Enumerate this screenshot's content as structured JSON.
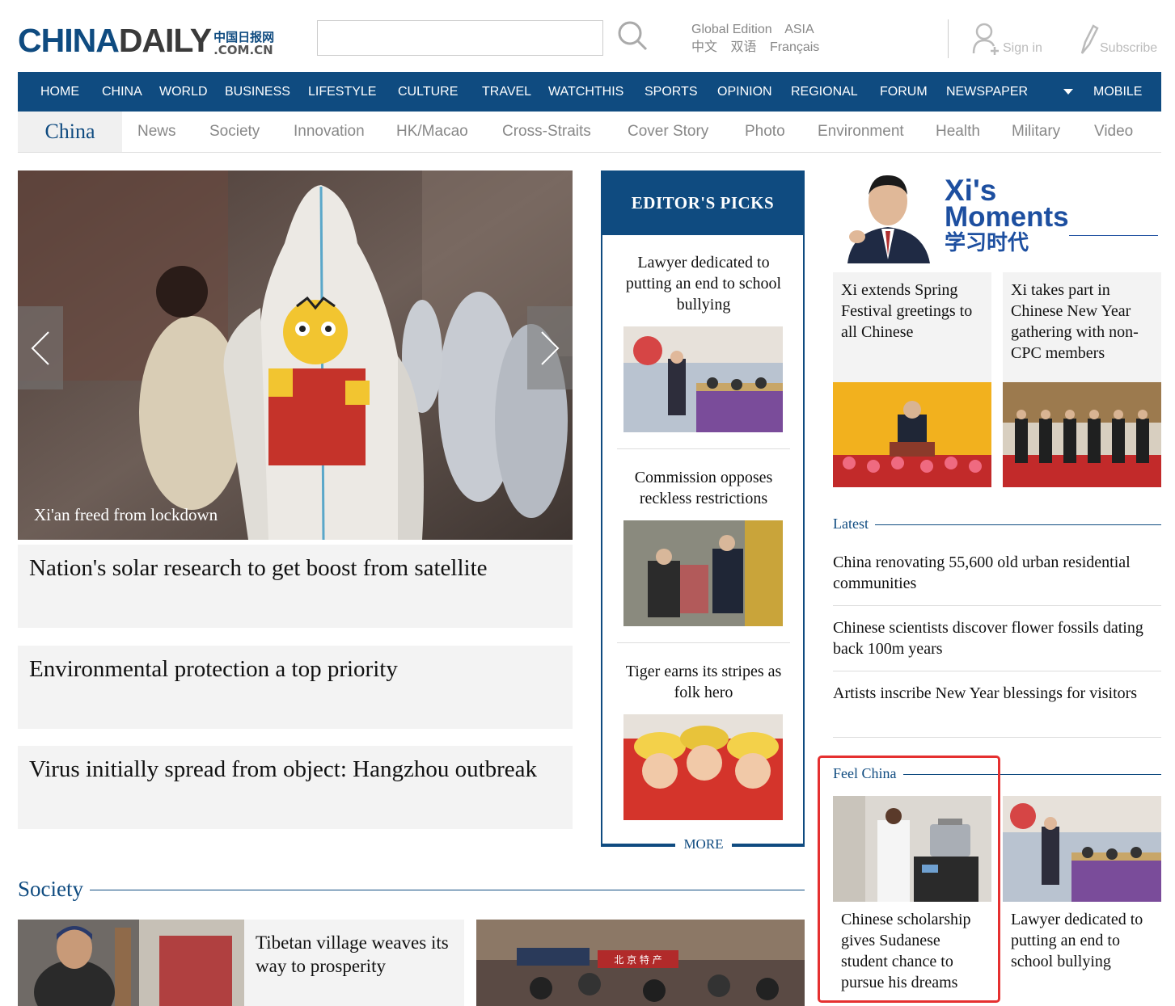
{
  "header": {
    "logo_main": "CHINA",
    "logo_dim": "DAILY",
    "logo_cn": "中国日报网",
    "logo_com": ".COM.CN",
    "search_placeholder": "",
    "editions": [
      "Global Edition",
      "ASIA"
    ],
    "languages": [
      "中文",
      "双语",
      "Français"
    ],
    "signin": "Sign in",
    "subscribe": "Subscribe"
  },
  "main_nav": {
    "items": [
      "HOME",
      "CHINA",
      "WORLD",
      "BUSINESS",
      "LIFESTYLE",
      "CULTURE",
      "TRAVEL",
      "WATCHTHIS",
      "SPORTS",
      "OPINION",
      "REGIONAL",
      "FORUM",
      "NEWSPAPER",
      "MOBILE"
    ]
  },
  "sub_nav": {
    "section": "China",
    "items": [
      "News",
      "Society",
      "Innovation",
      "HK/Macao",
      "Cross-Straits",
      "Cover Story",
      "Photo",
      "Environment",
      "Health",
      "Military",
      "Video"
    ]
  },
  "hero": {
    "caption": "Xi'an freed from lockdown"
  },
  "headlines": [
    "Nation's solar research to get boost from satellite",
    "Environmental protection a top priority",
    "Virus initially spread from object: Hangzhou outbreak"
  ],
  "editors_picks": {
    "title": "EDITOR'S PICKS",
    "items": [
      "Lawyer dedicated to putting an end to school bullying",
      "Commission opposes reckless restrictions",
      "Tiger earns its stripes as folk hero"
    ],
    "more": "MORE"
  },
  "xi_moments": {
    "title_en_1": "Xi's",
    "title_en_2": "Moments",
    "title_cn": "学习时代",
    "stories": [
      "Xi extends Spring Festival greetings to all Chinese",
      "Xi takes part in Chinese New Year gathering with non-CPC members"
    ]
  },
  "latest": {
    "label": "Latest",
    "items": [
      "China renovating 55,600 old urban residential communities",
      "Chinese scientists discover flower fossils dating back 100m years",
      "Artists inscribe New Year blessings for visitors"
    ]
  },
  "feel_china": {
    "label": "Feel China",
    "items": [
      "Chinese scholarship gives Sudanese student chance to pursue his dreams",
      "Lawyer dedicated to putting an end to school bullying"
    ]
  },
  "society": {
    "label": "Society",
    "items": [
      "Tibetan village weaves its way to prosperity"
    ],
    "sign_text": "北 京 特 产"
  },
  "colors": {
    "brand_blue": "#0f4b80",
    "highlight_red": "#e53030"
  }
}
